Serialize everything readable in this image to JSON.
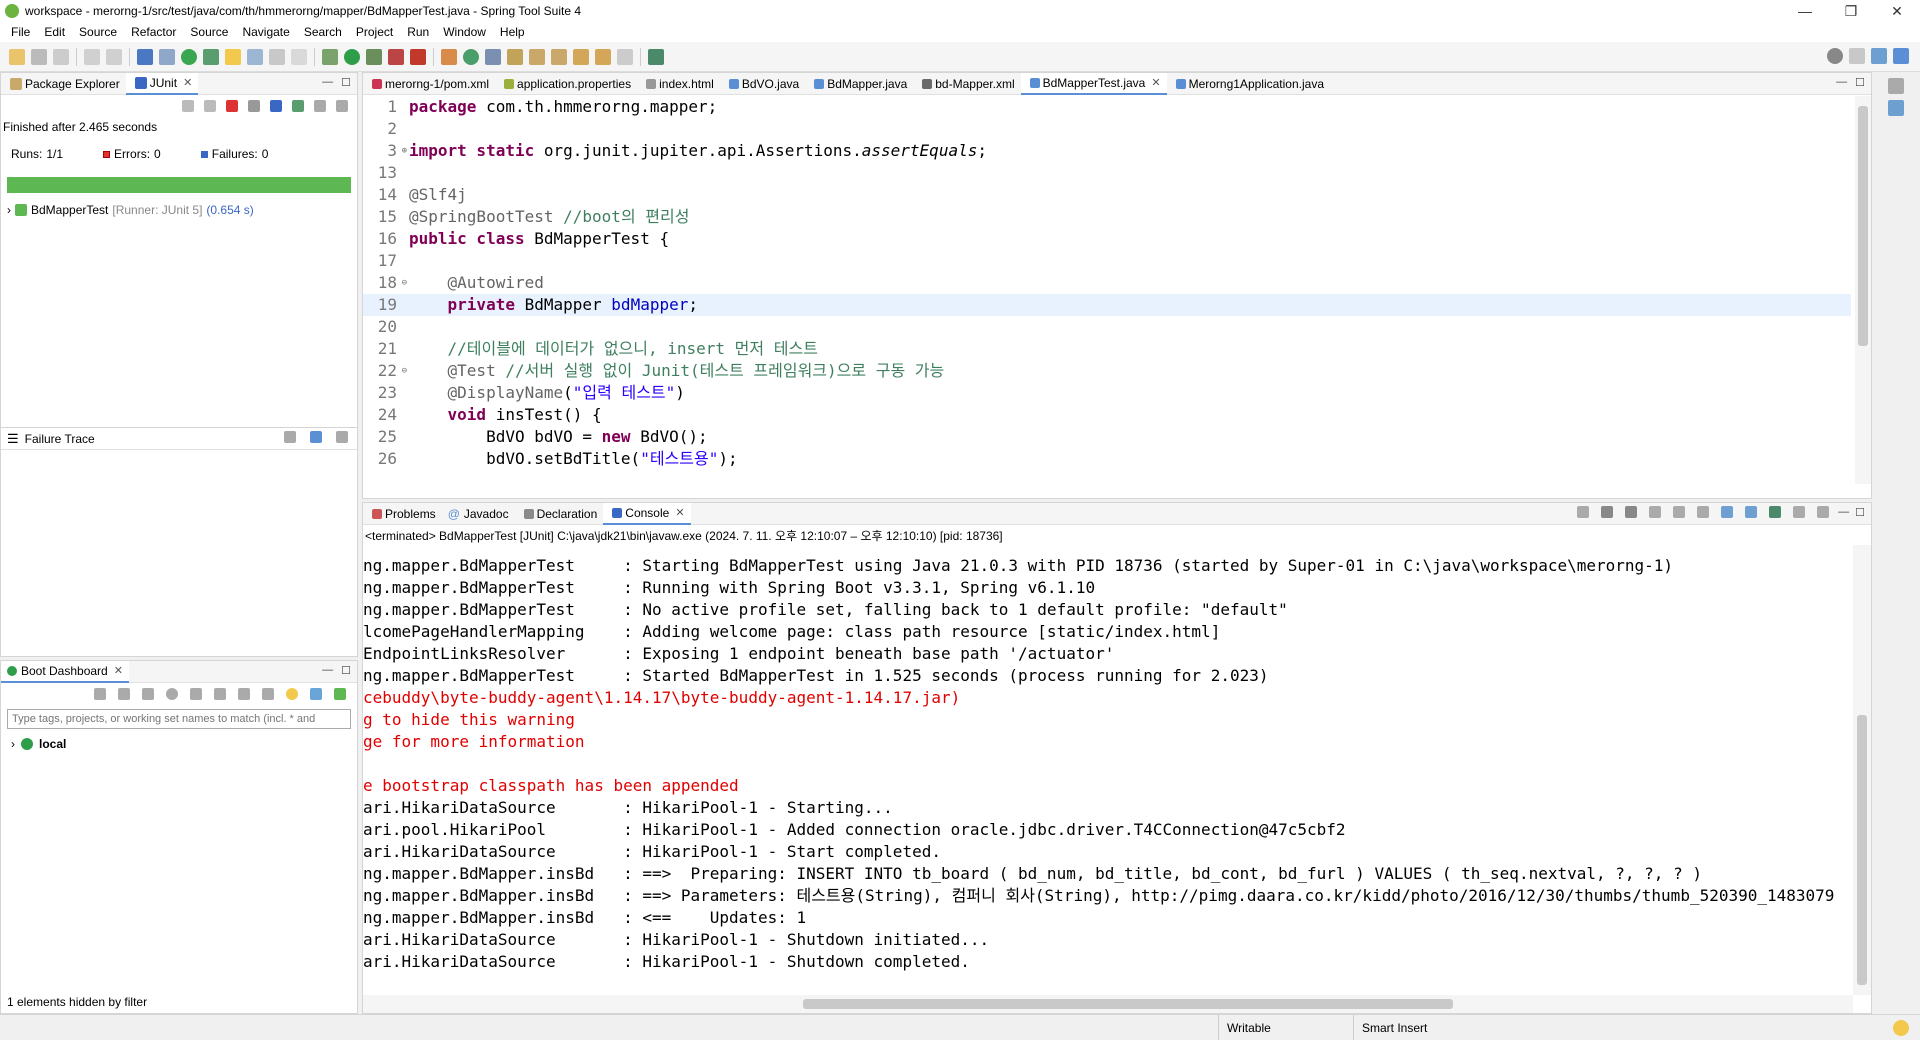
{
  "window": {
    "title": "workspace - merorng-1/src/test/java/com/th/hmmerorng/mapper/BdMapperTest.java - Spring Tool Suite 4",
    "minimize": "—",
    "maximize": "❐",
    "close": "✕"
  },
  "menu": [
    "File",
    "Edit",
    "Source",
    "Refactor",
    "Source",
    "Navigate",
    "Search",
    "Project",
    "Run",
    "Window",
    "Help"
  ],
  "left_top": {
    "tabs": [
      {
        "label": "Package Explorer",
        "active": false
      },
      {
        "label": "JUnit",
        "active": true
      }
    ],
    "status": "Finished after 2.465 seconds",
    "runs_label": "Runs:",
    "runs_value": "1/1",
    "errors_label": "Errors:",
    "errors_value": "0",
    "failures_label": "Failures:",
    "failures_value": "0",
    "progress": 1.0,
    "test_name": "BdMapperTest",
    "test_runner": "[Runner: JUnit 5]",
    "test_time": "(0.654 s)"
  },
  "failure_trace": {
    "title": "Failure Trace"
  },
  "boot_dashboard": {
    "title": "Boot Dashboard",
    "filter_placeholder": "Type tags, projects, or working set names to match (incl. * and",
    "local_label": "local",
    "hidden_note": "1 elements hidden by filter"
  },
  "editor": {
    "tabs": [
      {
        "label": "merorng-1/pom.xml",
        "active": false
      },
      {
        "label": "application.properties",
        "active": false
      },
      {
        "label": "index.html",
        "active": false
      },
      {
        "label": "BdVO.java",
        "active": false
      },
      {
        "label": "BdMapper.java",
        "active": false
      },
      {
        "label": "bd-Mapper.xml",
        "active": false
      },
      {
        "label": "BdMapperTest.java",
        "active": true
      },
      {
        "label": "Merorng1Application.java",
        "active": false
      }
    ],
    "lines": [
      {
        "n": "1",
        "text": "package com.th.hmmerorng.mapper;"
      },
      {
        "n": "2",
        "text": ""
      },
      {
        "n": "3",
        "text": "import static org.junit.jupiter.api.Assertions.assertEquals;"
      },
      {
        "n": "13",
        "text": ""
      },
      {
        "n": "14",
        "text": "@Slf4j"
      },
      {
        "n": "15",
        "text": "@SpringBootTest //boot의 편리성"
      },
      {
        "n": "16",
        "text": "public class BdMapperTest {"
      },
      {
        "n": "17",
        "text": ""
      },
      {
        "n": "18",
        "text": "    @Autowired"
      },
      {
        "n": "19",
        "text": "    private BdMapper bdMapper;"
      },
      {
        "n": "20",
        "text": ""
      },
      {
        "n": "21",
        "text": "    //테이블에 데이터가 없으니, insert 먼저 테스트"
      },
      {
        "n": "22",
        "text": "    @Test //서버 실행 없이 Junit(테스트 프레임워크)으로 구동 가능"
      },
      {
        "n": "23",
        "text": "    @DisplayName(\"입력 테스트\")"
      },
      {
        "n": "24",
        "text": "    void insTest() {"
      },
      {
        "n": "25",
        "text": "        BdVO bdVO = new BdVO();"
      },
      {
        "n": "26",
        "text": "        bdVO.setBdTitle(\"테스트용\");"
      }
    ]
  },
  "bottom": {
    "tabs": [
      {
        "label": "Problems",
        "active": false
      },
      {
        "label": "Javadoc",
        "active": false
      },
      {
        "label": "Declaration",
        "active": false
      },
      {
        "label": "Console",
        "active": true
      }
    ],
    "subtitle": "<terminated> BdMapperTest [JUnit] C:\\java\\jdk21\\bin\\javaw.exe  (2024. 7. 11. 오후 12:10:07 – 오후 12:10:10) [pid: 18736]",
    "lines": [
      {
        "t": "ng.mapper.BdMapperTest     : Starting BdMapperTest using Java 21.0.3 with PID 18736 (started by Super-01 in C:\\java\\workspace\\merorng-1)",
        "err": false
      },
      {
        "t": "ng.mapper.BdMapperTest     : Running with Spring Boot v3.3.1, Spring v6.1.10",
        "err": false
      },
      {
        "t": "ng.mapper.BdMapperTest     : No active profile set, falling back to 1 default profile: \"default\"",
        "err": false
      },
      {
        "t": "lcomePageHandlerMapping    : Adding welcome page: class path resource [static/index.html]",
        "err": false
      },
      {
        "t": "EndpointLinksResolver      : Exposing 1 endpoint beneath base path '/actuator'",
        "err": false
      },
      {
        "t": "ng.mapper.BdMapperTest     : Started BdMapperTest in 1.525 seconds (process running for 2.023)",
        "err": false
      },
      {
        "t": "cebuddy\\byte-buddy-agent\\1.14.17\\byte-buddy-agent-1.14.17.jar)",
        "err": true
      },
      {
        "t": "g to hide this warning",
        "err": true
      },
      {
        "t": "ge for more information",
        "err": true
      },
      {
        "t": "",
        "err": false
      },
      {
        "t": "e bootstrap classpath has been appended",
        "err": true
      },
      {
        "t": "ari.HikariDataSource       : HikariPool-1 - Starting...",
        "err": false
      },
      {
        "t": "ari.pool.HikariPool        : HikariPool-1 - Added connection oracle.jdbc.driver.T4CConnection@47c5cbf2",
        "err": false
      },
      {
        "t": "ari.HikariDataSource       : HikariPool-1 - Start completed.",
        "err": false
      },
      {
        "t": "ng.mapper.BdMapper.insBd   : ==>  Preparing: INSERT INTO tb_board ( bd_num, bd_title, bd_cont, bd_furl ) VALUES ( th_seq.nextval, ?, ?, ? )",
        "err": false
      },
      {
        "t": "ng.mapper.BdMapper.insBd   : ==> Parameters: 테스트용(String), 컴퍼니 회사(String), http://pimg.daara.co.kr/kidd/photo/2016/12/30/thumbs/thumb_520390_1483079",
        "err": false
      },
      {
        "t": "ng.mapper.BdMapper.insBd   : <==    Updates: 1",
        "err": false
      },
      {
        "t": "ari.HikariDataSource       : HikariPool-1 - Shutdown initiated...",
        "err": false
      },
      {
        "t": "ari.HikariDataSource       : HikariPool-1 - Shutdown completed.",
        "err": false
      }
    ]
  },
  "status": {
    "writable": "Writable",
    "insert_mode": "Smart Insert"
  },
  "colors": {
    "keyword": "#7f0055",
    "comment": "#3f7f5f",
    "string": "#2a00ff",
    "error_text": "#e00000",
    "progress_green": "#5db854"
  }
}
